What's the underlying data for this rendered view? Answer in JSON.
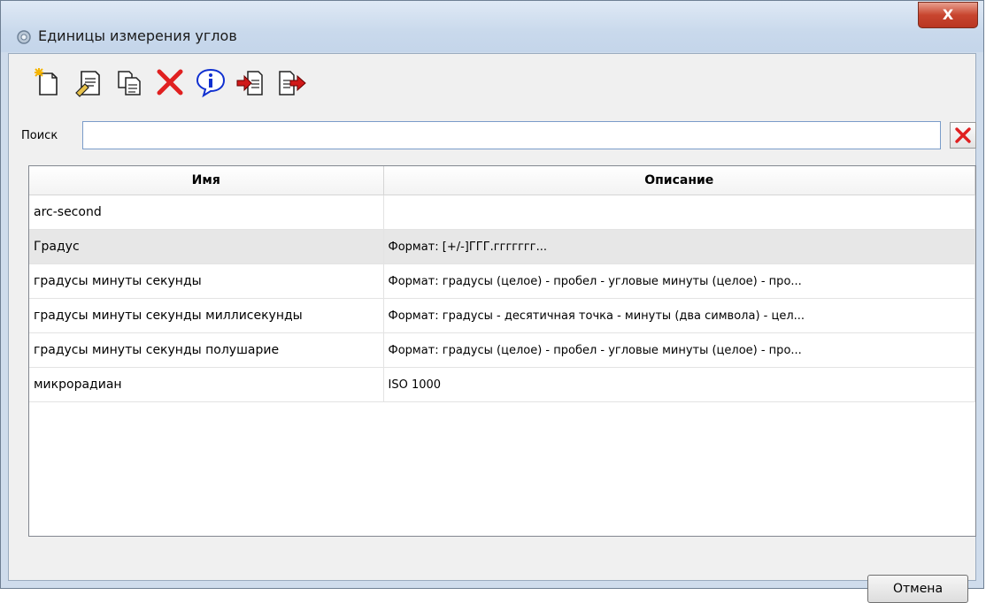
{
  "window": {
    "title": "Единицы измерения углов",
    "close_label": "X"
  },
  "toolbar": {
    "buttons": [
      {
        "icon": "new-document-icon"
      },
      {
        "icon": "edit-icon"
      },
      {
        "icon": "copy-icon"
      },
      {
        "icon": "delete-icon"
      },
      {
        "icon": "info-icon"
      },
      {
        "icon": "import-icon"
      },
      {
        "icon": "export-icon"
      }
    ]
  },
  "search": {
    "label": "Поиск",
    "value": "",
    "placeholder": ""
  },
  "table": {
    "columns": [
      "Имя",
      "Описание"
    ],
    "rows": [
      {
        "name": "arc-second",
        "description": ""
      },
      {
        "name": "Градус",
        "description": "Формат: [+/-]ГГГ.ггггггг..."
      },
      {
        "name": "градусы минуты секунды",
        "description": "Формат: градусы (целое) - пробел - угловые минуты (целое) - про..."
      },
      {
        "name": "градусы минуты секунды миллисекунды",
        "description": "Формат: градусы - десятичная точка - минуты (два символа) - цел..."
      },
      {
        "name": "градусы минуты секунды полушарие",
        "description": "Формат: градусы (целое) - пробел - угловые минуты (целое) - про..."
      },
      {
        "name": "микрорадиан",
        "description": "ISO 1000"
      }
    ],
    "selected_row": "Градус"
  },
  "footer": {
    "cancel_label": "Отмена"
  },
  "colors": {
    "delete_red": "#e02020",
    "info_blue": "#1030d0",
    "arrow_red": "#d01818"
  }
}
